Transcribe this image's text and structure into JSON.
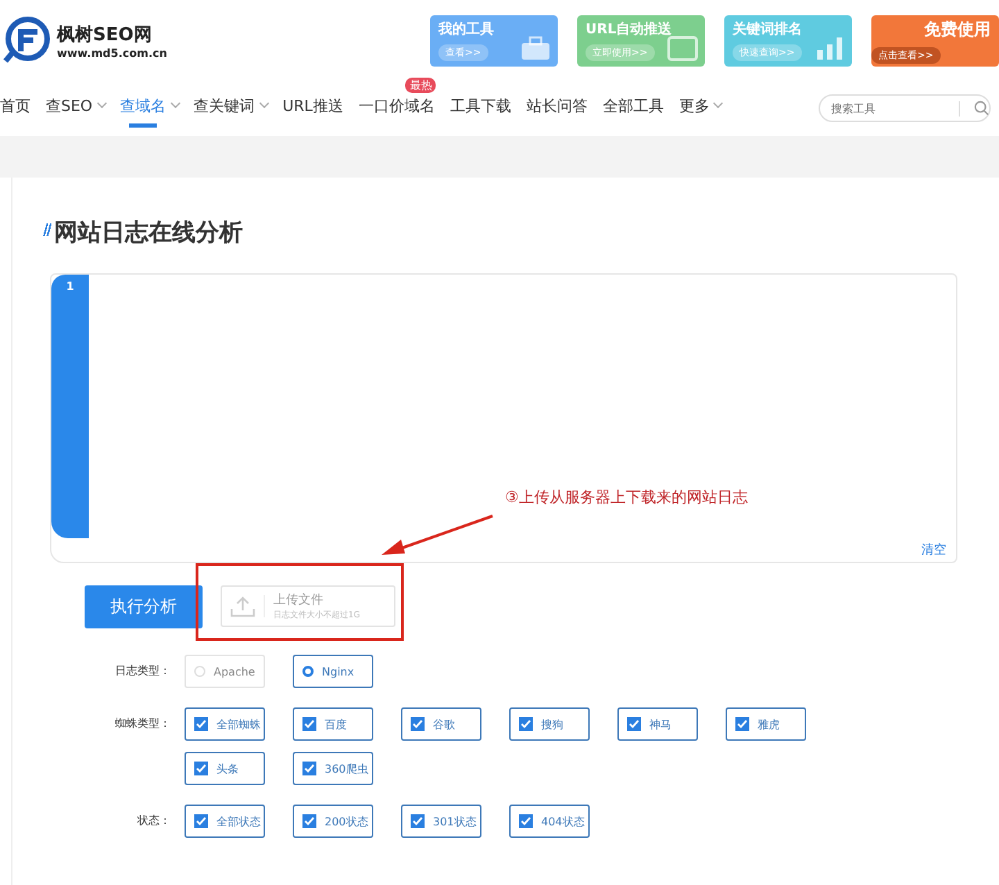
{
  "logo": {
    "name": "枫树SEO网",
    "url": "www.md5.com.cn"
  },
  "banners": [
    {
      "kind": "tool",
      "title": "我的工具",
      "link": "查看>>",
      "color": "#6aaef5"
    },
    {
      "kind": "tool",
      "title": "URL自动推送",
      "link": "立即使用>>",
      "color": "#7dcf8e"
    },
    {
      "kind": "tool",
      "title": "关键词排名",
      "link": "快速查询>>",
      "color": "#5fcbe0"
    },
    {
      "kind": "promo",
      "title": "免费使用",
      "link": "点击查看>>",
      "color": "#f2773a"
    }
  ],
  "nav": [
    {
      "label": "首页",
      "dropdown": false,
      "selected": false
    },
    {
      "label": "查SEO",
      "dropdown": true,
      "selected": false
    },
    {
      "label": "查域名",
      "dropdown": true,
      "selected": true
    },
    {
      "label": "查关键词",
      "dropdown": true,
      "selected": false
    },
    {
      "label": "URL推送",
      "dropdown": false,
      "selected": false
    },
    {
      "label": "一口价域名",
      "dropdown": false,
      "selected": false,
      "badge": "最热"
    },
    {
      "label": "工具下载",
      "dropdown": false,
      "selected": false
    },
    {
      "label": "站长问答",
      "dropdown": false,
      "selected": false
    },
    {
      "label": "全部工具",
      "dropdown": false,
      "selected": false
    },
    {
      "label": "更多",
      "dropdown": true,
      "selected": false
    }
  ],
  "search": {
    "placeholder": "搜索工具"
  },
  "page_title": "网站日志在线分析",
  "editor": {
    "line_number": "1",
    "clear_link": "清空"
  },
  "run_button": "执行分析",
  "upload": {
    "title": "上传文件",
    "hint": "日志文件大小不超过1G"
  },
  "annotation": "③上传从服务器上下载来的网站日志",
  "option_groups": [
    {
      "label": "日志类型：",
      "kind": "radio",
      "options": [
        {
          "label": "Apache",
          "selected": false
        },
        {
          "label": "Nginx",
          "selected": true
        }
      ]
    },
    {
      "label": "蜘蛛类型：",
      "kind": "checkbox",
      "options": [
        {
          "label": "全部蜘蛛",
          "checked": true
        },
        {
          "label": "百度",
          "checked": true
        },
        {
          "label": "谷歌",
          "checked": true
        },
        {
          "label": "搜狗",
          "checked": true
        },
        {
          "label": "神马",
          "checked": true
        },
        {
          "label": "雅虎",
          "checked": true
        },
        {
          "label": "头条",
          "checked": true
        },
        {
          "label": "360爬虫",
          "checked": true
        }
      ]
    },
    {
      "label": "状态：",
      "kind": "checkbox",
      "options": [
        {
          "label": "全部状态",
          "checked": true
        },
        {
          "label": "200状态",
          "checked": true
        },
        {
          "label": "301状态",
          "checked": true
        },
        {
          "label": "404状态",
          "checked": true
        }
      ]
    }
  ]
}
